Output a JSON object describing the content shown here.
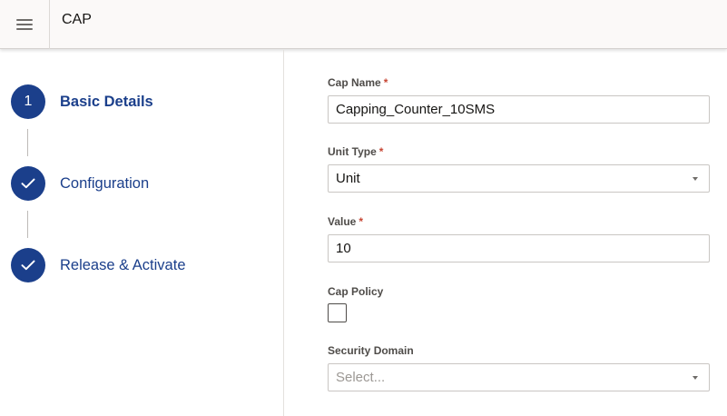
{
  "header": {
    "title": "CAP",
    "menu_icon": "hamburger-menu-icon"
  },
  "steps": [
    {
      "number": "1",
      "label": "Basic Details",
      "state": "current"
    },
    {
      "number": "",
      "label": "Configuration",
      "state": "completed",
      "icon": "checkmark-icon"
    },
    {
      "number": "",
      "label": "Release & Activate",
      "state": "completed",
      "icon": "checkmark-icon"
    }
  ],
  "form": {
    "cap_name": {
      "label": "Cap Name",
      "required": "*",
      "value": "Capping_Counter_10SMS"
    },
    "unit_type": {
      "label": "Unit Type",
      "required": "*",
      "value": "Unit"
    },
    "value": {
      "label": "Value",
      "required": "*",
      "value": "10"
    },
    "cap_policy": {
      "label": "Cap Policy",
      "checked": false
    },
    "security_domain": {
      "label": "Security Domain",
      "placeholder": "Select..."
    }
  },
  "colors": {
    "accent": "#1b3f8b",
    "required": "#c74634",
    "header_bg": "#fbf9f8"
  }
}
